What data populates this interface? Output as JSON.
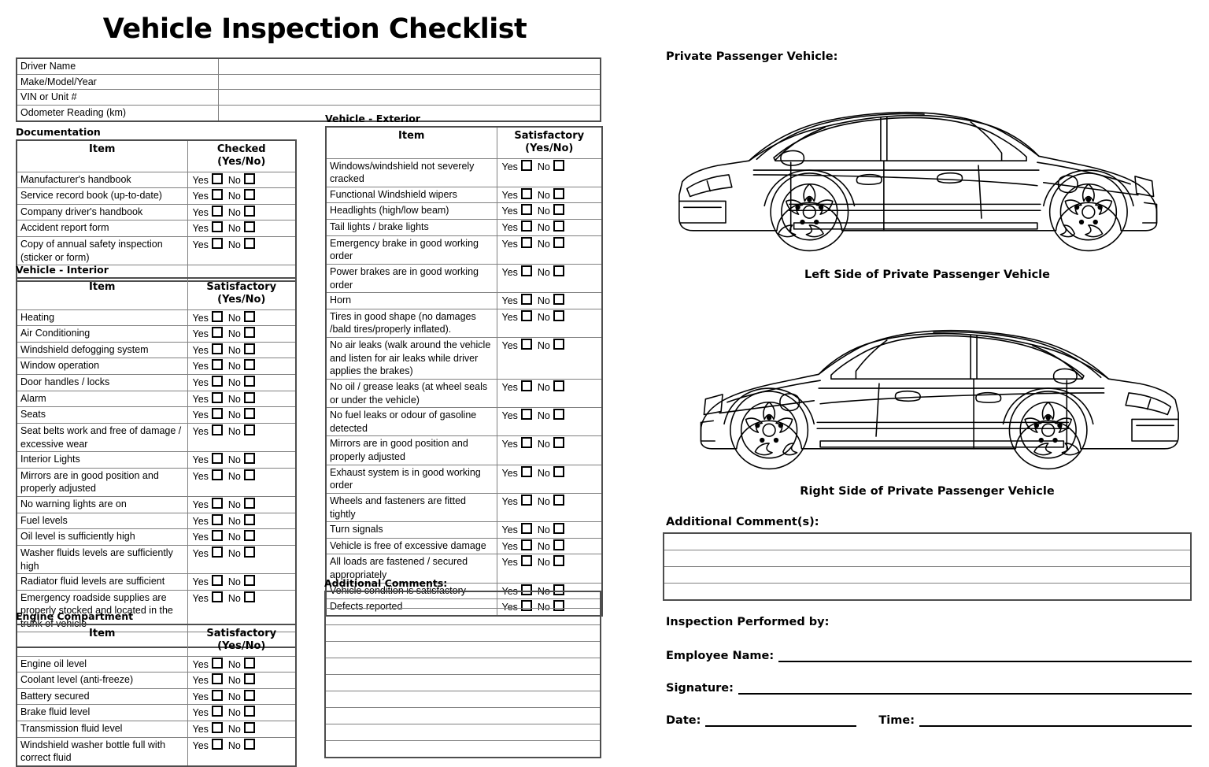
{
  "document": {
    "title": "Vehicle Inspection Checklist"
  },
  "info_table": {
    "rows": [
      {
        "label": "Driver Name",
        "value": ""
      },
      {
        "label": "Make/Model/Year",
        "value": ""
      },
      {
        "label": "VIN  or Unit #",
        "value": ""
      },
      {
        "label": "Odometer Reading (km)",
        "value": ""
      }
    ]
  },
  "yes_no": {
    "yes": "Yes",
    "no": "No"
  },
  "sections": {
    "documentation": {
      "label": "Documentation",
      "header_item": "Item",
      "header_answer_line1": "Checked",
      "header_answer_line2": "(Yes/No)",
      "items": [
        "Manufacturer's handbook",
        "Service record book (up-to-date)",
        "Company driver's handbook",
        "Accident report form",
        "Copy of annual safety inspection (sticker or form)"
      ]
    },
    "interior": {
      "label": "Vehicle - Interior",
      "header_item": "Item",
      "header_answer_line1": "Satisfactory",
      "header_answer_line2": "(Yes/No)",
      "items": [
        "Heating",
        "Air Conditioning",
        "Windshield defogging system",
        "Window operation",
        "Door handles / locks",
        "Alarm",
        "Seats",
        "Seat belts work and free of damage / excessive wear",
        "Interior Lights",
        "Mirrors are in good position and properly adjusted",
        "No warning lights are on",
        "Fuel levels",
        "Oil level is sufficiently high",
        "Washer fluids levels are sufficiently high",
        "Radiator fluid levels are sufficient",
        "Emergency roadside supplies are properly stocked and located in the trunk of vehicle"
      ]
    },
    "engine": {
      "label": "Engine Compartment",
      "header_item": "Item",
      "header_answer_line1": "Satisfactory",
      "header_answer_line2": "(Yes/No)",
      "items": [
        "Engine oil level",
        "Coolant level (anti-freeze)",
        "Battery secured",
        "Brake fluid level",
        "Transmission fluid level",
        "Windshield washer bottle full with correct fluid"
      ]
    },
    "exterior": {
      "label": "Vehicle - Exterior",
      "header_item": "Item",
      "header_answer_line1": "Satisfactory",
      "header_answer_line2": "(Yes/No)",
      "items": [
        "Windows/windshield not severely cracked",
        "Functional Windshield wipers",
        "Headlights (high/low beam)",
        "Tail lights / brake lights",
        "Emergency brake in good working order",
        "Power brakes are in good working order",
        "Horn",
        "Tires in good shape (no damages /bald tires/properly inflated).",
        "No air leaks (walk around  the vehicle and listen for air leaks while driver applies the brakes)",
        "No oil / grease leaks (at wheel seals or under the vehicle)",
        "No fuel leaks or odour of gasoline detected",
        "Mirrors are in good position and properly adjusted",
        "Exhaust system is in good working order",
        "Wheels and fasteners are fitted tightly",
        "Turn signals",
        "Vehicle is free of excessive damage",
        "All loads are fastened / secured appropriately",
        "Vehicle condition is satisfactory",
        "Defects reported"
      ]
    }
  },
  "middle_comments": {
    "label": "Additional Comments:",
    "line_count": 10
  },
  "vehicle_diagrams": {
    "heading": "Private Passenger Vehicle:",
    "left_caption": "Left Side of Private Passenger Vehicle",
    "right_caption": "Right Side of Private Passenger Vehicle"
  },
  "right_comments": {
    "label": "Additional Comment(s):",
    "line_count": 4
  },
  "signature": {
    "heading": "Inspection Performed by:",
    "employee_name_label": "Employee Name:",
    "signature_label": "Signature:",
    "date_label": "Date:",
    "time_label": "Time:"
  },
  "colors": {
    "ink": "#000000",
    "grid_line": "#808080",
    "outer_border": "#4d4d4d",
    "paper": "#ffffff"
  }
}
